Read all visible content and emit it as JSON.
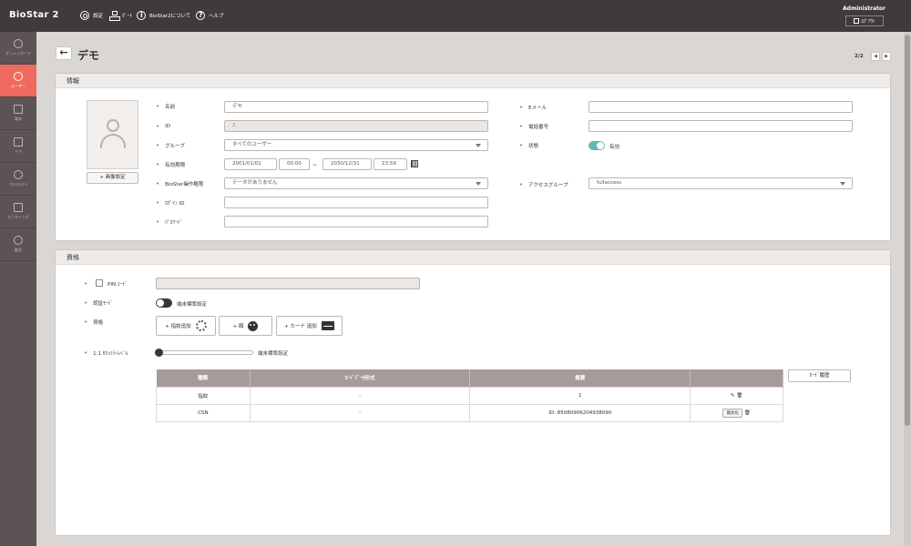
{
  "app": {
    "title": "BioStar 2"
  },
  "topnav": [
    {
      "label": "設定",
      "icon": "gear-icon"
    },
    {
      "label": "ﾎﾟｰﾄ",
      "icon": "port-icon"
    },
    {
      "label": "BioStar2について",
      "icon": "info-icon"
    },
    {
      "label": "ヘルプ",
      "icon": "help-icon"
    }
  ],
  "user": {
    "name": "Administrator",
    "logout_label": "ﾛｸﾞｱｳﾄ"
  },
  "sidebar": [
    {
      "label": "ダッシュボード",
      "icon": "dashboard-icon",
      "active": false
    },
    {
      "label": "ユーザー",
      "icon": "user-icon",
      "active": true
    },
    {
      "label": "端末",
      "icon": "device-icon",
      "active": false
    },
    {
      "label": "ドア",
      "icon": "door-icon",
      "active": false
    },
    {
      "label": "ｱｸｾｽｺﾝﾄﾛｰﾙ",
      "icon": "access-control-icon",
      "active": false
    },
    {
      "label": "モニタリング",
      "icon": "monitoring-icon",
      "active": false
    },
    {
      "label": "勤怠",
      "icon": "time-attendance-icon",
      "active": false
    }
  ],
  "page": {
    "title": "デモ",
    "pager": "2/2"
  },
  "info": {
    "header": "情報",
    "image_button": "+ 画像設定",
    "name_label": "名前",
    "name_value": "デモ",
    "id_label": "ID",
    "id_value": "2",
    "group_label": "グループ",
    "group_value": "すべてのユーザー",
    "period_label": "有効期限",
    "start_date": "2001/01/01",
    "start_time": "00:00",
    "period_sep": "~",
    "end_date": "2030/12/31",
    "end_time": "23:59",
    "operator_label": "BioStar操作権限",
    "operator_value": "データがありません",
    "login_label": "ﾛｸﾞｲﾝ ID",
    "login_value": "",
    "password_label": "ﾊﾟｽﾜｰﾄﾞ",
    "password_value": "",
    "email_label": "Eメール",
    "email_value": "",
    "phone_label": "電話番号",
    "phone_value": "",
    "status_label": "状態",
    "status_value": "有効",
    "status_on": true,
    "access_label": "アクセスグループ",
    "access_value": "fullaccess"
  },
  "credential": {
    "header": "資格",
    "pin_label": "PIN ｺｰﾄﾞ",
    "pin_value": "",
    "auth_label": "認証ﾓｰﾄﾞ",
    "auth_toggle_label": "端末標準設定",
    "cred_label": "資格",
    "btn_fp": "+ 指紋追加",
    "btn_face": "+ 顔",
    "btn_card": "+ カード 追加",
    "security_label": "1:1 ｾｷｭﾘﾃｨﾚﾍﾞﾙ",
    "security_value": "端末標準設定",
    "table": {
      "headers": [
        "種類",
        "ｶｰﾄﾞﾃﾞｰﾀ形式",
        "概要",
        ""
      ],
      "rows": [
        {
          "type": "指紋",
          "format": "-",
          "summary": "1"
        },
        {
          "type": "CSN",
          "format": "-",
          "summary": "ID: 85080906204938090",
          "action": "無効化"
        }
      ]
    },
    "history_button": "ｶｰﾄﾞ履歴"
  },
  "colors": {
    "accent": "#ef6b5e",
    "toggle_on": "#5fb8b6",
    "topbar": "#3f3a3b",
    "sidebar": "#5b5356"
  }
}
